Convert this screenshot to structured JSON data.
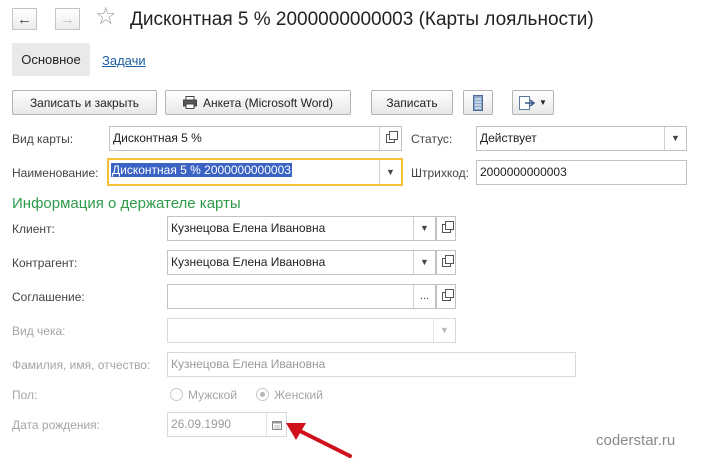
{
  "window": {
    "title": "Дисконтная 5 % 2000000000003 (Карты лояльности)"
  },
  "tabs": {
    "main": "Основное",
    "tasks": "Задачи"
  },
  "toolbar": {
    "save_close": "Записать и закрыть",
    "questionnaire": "Анкета (Microsoft Word)",
    "save": "Записать"
  },
  "form": {
    "card_type": {
      "label": "Вид карты:",
      "value": "Дисконтная 5 %"
    },
    "name": {
      "label": "Наименование:",
      "value": "Дисконтная 5 % 2000000000003"
    },
    "status": {
      "label": "Статус:",
      "value": "Действует"
    },
    "barcode": {
      "label": "Штрихкод:",
      "value": "2000000000003"
    }
  },
  "holder": {
    "section_title": "Информация о держателе карты",
    "client": {
      "label": "Клиент:",
      "value": "Кузнецова Елена Ивановна"
    },
    "counterparty": {
      "label": "Контрагент:",
      "value": "Кузнецова Елена Ивановна"
    },
    "agreement": {
      "label": "Соглашение:",
      "value": ""
    },
    "receipt_type": {
      "label": "Вид чека:",
      "value": ""
    },
    "full_name": {
      "label": "Фамилия, имя, отчество:",
      "value": "Кузнецова Елена Ивановна"
    },
    "gender": {
      "label": "Пол:",
      "male": "Мужской",
      "female": "Женский",
      "selected": "female"
    },
    "birth_date": {
      "label": "Дата рождения:",
      "value": "26.09.1990"
    }
  },
  "watermark": "coderstar.ru",
  "colors": {
    "section": "#2e9c4a",
    "focus_border": "#f5c035",
    "selection": "#3b63c4",
    "arrow": "#d0101a",
    "link": "#1d5ea0"
  }
}
